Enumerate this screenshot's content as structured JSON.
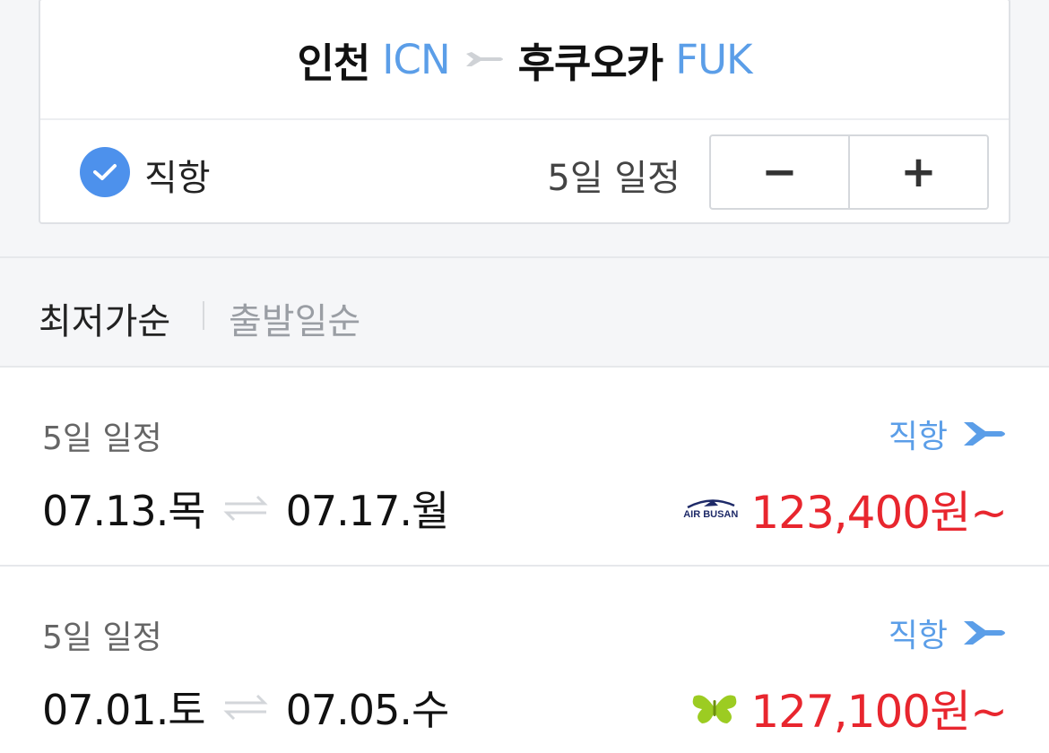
{
  "route": {
    "origin_name": "인천",
    "origin_code": "ICN",
    "dest_name": "후쿠오카",
    "dest_code": "FUK"
  },
  "options": {
    "direct_label": "직항",
    "direct_checked": true,
    "days_label": "5일 일정",
    "minus_label": "−",
    "plus_label": "+"
  },
  "sort": {
    "active": "최저가순",
    "inactive": "출발일순"
  },
  "flights": [
    {
      "days": "5일 일정",
      "direct": "직항",
      "depart": "07.13.목",
      "return": "07.17.월",
      "airline_logo_text": "AIR BUSAN",
      "price": "123,400원~"
    },
    {
      "days": "5일 일정",
      "direct": "직항",
      "depart": "07.01.토",
      "return": "07.05.수",
      "airline": "butterfly-logo",
      "price": "127,100원~"
    }
  ],
  "colors": {
    "accent_blue": "#5b9ee8",
    "check_blue": "#4d91ec",
    "price_red": "#e8262e",
    "background_gray": "#f5f6f8"
  }
}
